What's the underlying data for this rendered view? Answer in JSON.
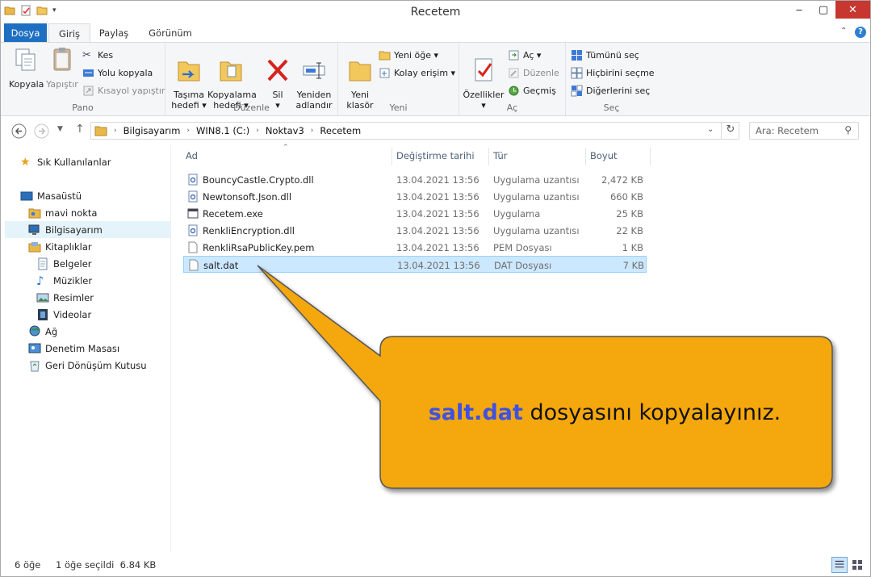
{
  "window": {
    "title": "Recetem",
    "min": "‒",
    "max": "▢",
    "close": "✕"
  },
  "tabs": {
    "file": "Dosya",
    "home": "Giriş",
    "share": "Paylaş",
    "view": "Görünüm"
  },
  "ribbon": {
    "clipboard": {
      "label": "Pano",
      "copy": "Kopyala",
      "paste": "Yapıştır",
      "cut": "Kes",
      "copy_path": "Yolu kopyala",
      "paste_shortcut": "Kısayol yapıştır"
    },
    "organize": {
      "label": "Düzenle",
      "move_to": "Taşıma\nhedefi ▾",
      "copy_to": "Kopyalama\nhedefi ▾",
      "delete": "Sil\n▾",
      "rename": "Yeniden\nadlandır"
    },
    "new": {
      "label": "Yeni",
      "new_folder": "Yeni\nklasör",
      "new_item": "Yeni öğe ▾",
      "easy_access": "Kolay erişim ▾"
    },
    "open": {
      "label": "Aç",
      "properties": "Özellikler\n▾",
      "open": "Aç ▾",
      "edit": "Düzenle",
      "history": "Geçmiş"
    },
    "select": {
      "label": "Seç",
      "select_all": "Tümünü seç",
      "select_none": "Hiçbirini seçme",
      "invert": "Diğerlerini seç"
    }
  },
  "address": {
    "crumbs": [
      "Bilgisayarım",
      "WIN8.1 (C:)",
      "Noktav3",
      "Recetem"
    ],
    "search_placeholder": "Ara: Recetem"
  },
  "nav": {
    "favorites": "Sık Kullanılanlar",
    "desktop": "Masaüstü",
    "blue_dot": "mavi nokta",
    "computer": "Bilgisayarım",
    "libraries": "Kitaplıklar",
    "documents": "Belgeler",
    "music": "Müzikler",
    "pictures": "Resimler",
    "videos": "Videolar",
    "network": "Ağ",
    "control_panel": "Denetim Masası",
    "recycle_bin": "Geri Dönüşüm Kutusu"
  },
  "columns": {
    "name": "Ad",
    "date": "Değiştirme tarihi",
    "type": "Tür",
    "size": "Boyut"
  },
  "files": [
    {
      "name": "BouncyCastle.Crypto.dll",
      "date": "13.04.2021 13:56",
      "type": "Uygulama uzantısı",
      "size": "2,472 KB",
      "icon": "dll-icon"
    },
    {
      "name": "Newtonsoft.Json.dll",
      "date": "13.04.2021 13:56",
      "type": "Uygulama uzantısı",
      "size": "660 KB",
      "icon": "dll-icon"
    },
    {
      "name": "Recetem.exe",
      "date": "13.04.2021 13:56",
      "type": "Uygulama",
      "size": "25 KB",
      "icon": "exe-icon"
    },
    {
      "name": "RenkliEncryption.dll",
      "date": "13.04.2021 13:56",
      "type": "Uygulama uzantısı",
      "size": "22 KB",
      "icon": "dll-icon"
    },
    {
      "name": "RenkliRsaPublicKey.pem",
      "date": "13.04.2021 13:56",
      "type": "PEM Dosyası",
      "size": "1 KB",
      "icon": "file-icon"
    },
    {
      "name": "salt.dat",
      "date": "13.04.2021 13:56",
      "type": "DAT Dosyası",
      "size": "7 KB",
      "icon": "file-icon",
      "selected": true
    }
  ],
  "status": {
    "count": "6 öğe",
    "selection": "1 öğe seçildi  6.84 KB"
  },
  "callout": {
    "highlight": "salt.dat",
    "text": " dosyasını kopyalayınız.",
    "fill": "#f5a80c",
    "highlight_color": "#3f51e0"
  }
}
